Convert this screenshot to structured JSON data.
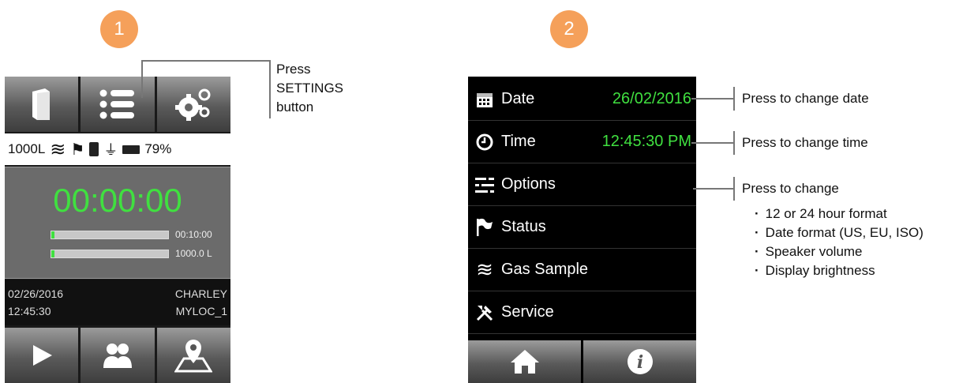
{
  "steps": [
    "1",
    "2"
  ],
  "device1": {
    "status_bar": {
      "volume": "1000L",
      "battery": "79%"
    },
    "timer": "00:00:00",
    "progress": [
      {
        "label": "00:10:00",
        "fraction": 0.03
      },
      {
        "label": "1000.0 L",
        "fraction": 0.03
      }
    ],
    "info": {
      "date": "02/26/2016",
      "time": "12:45:30",
      "user": "CHARLEY",
      "location": "MYLOC_1"
    },
    "top_buttons": [
      "book-icon",
      "list-icon",
      "gears-icon"
    ],
    "bottom_buttons": [
      "play-icon",
      "users-icon",
      "map-pin-icon"
    ]
  },
  "callout1": "Press\nSETTINGS\nbutton",
  "device2": {
    "menu": [
      {
        "label": "Date",
        "value": "26/02/2016",
        "icon": "calendar-icon"
      },
      {
        "label": "Time",
        "value": "12:45:30 PM",
        "icon": "clock-icon"
      },
      {
        "label": "Options",
        "value": "",
        "icon": "sliders-icon"
      },
      {
        "label": "Status",
        "value": "",
        "icon": "flag-icon"
      },
      {
        "label": "Gas Sample",
        "value": "",
        "icon": "waves-icon"
      },
      {
        "label": "Service",
        "value": "",
        "icon": "tools-icon"
      }
    ],
    "bottom_buttons": [
      "home-icon",
      "info-icon"
    ],
    "accent_color": "#40e040"
  },
  "callouts2": {
    "date": "Press to change date",
    "time": "Press to change time",
    "options": "Press to change",
    "options_bullets": [
      "12 or 24 hour format",
      "Date format (US, EU, ISO)",
      "Speaker volume",
      "Display brightness"
    ]
  }
}
